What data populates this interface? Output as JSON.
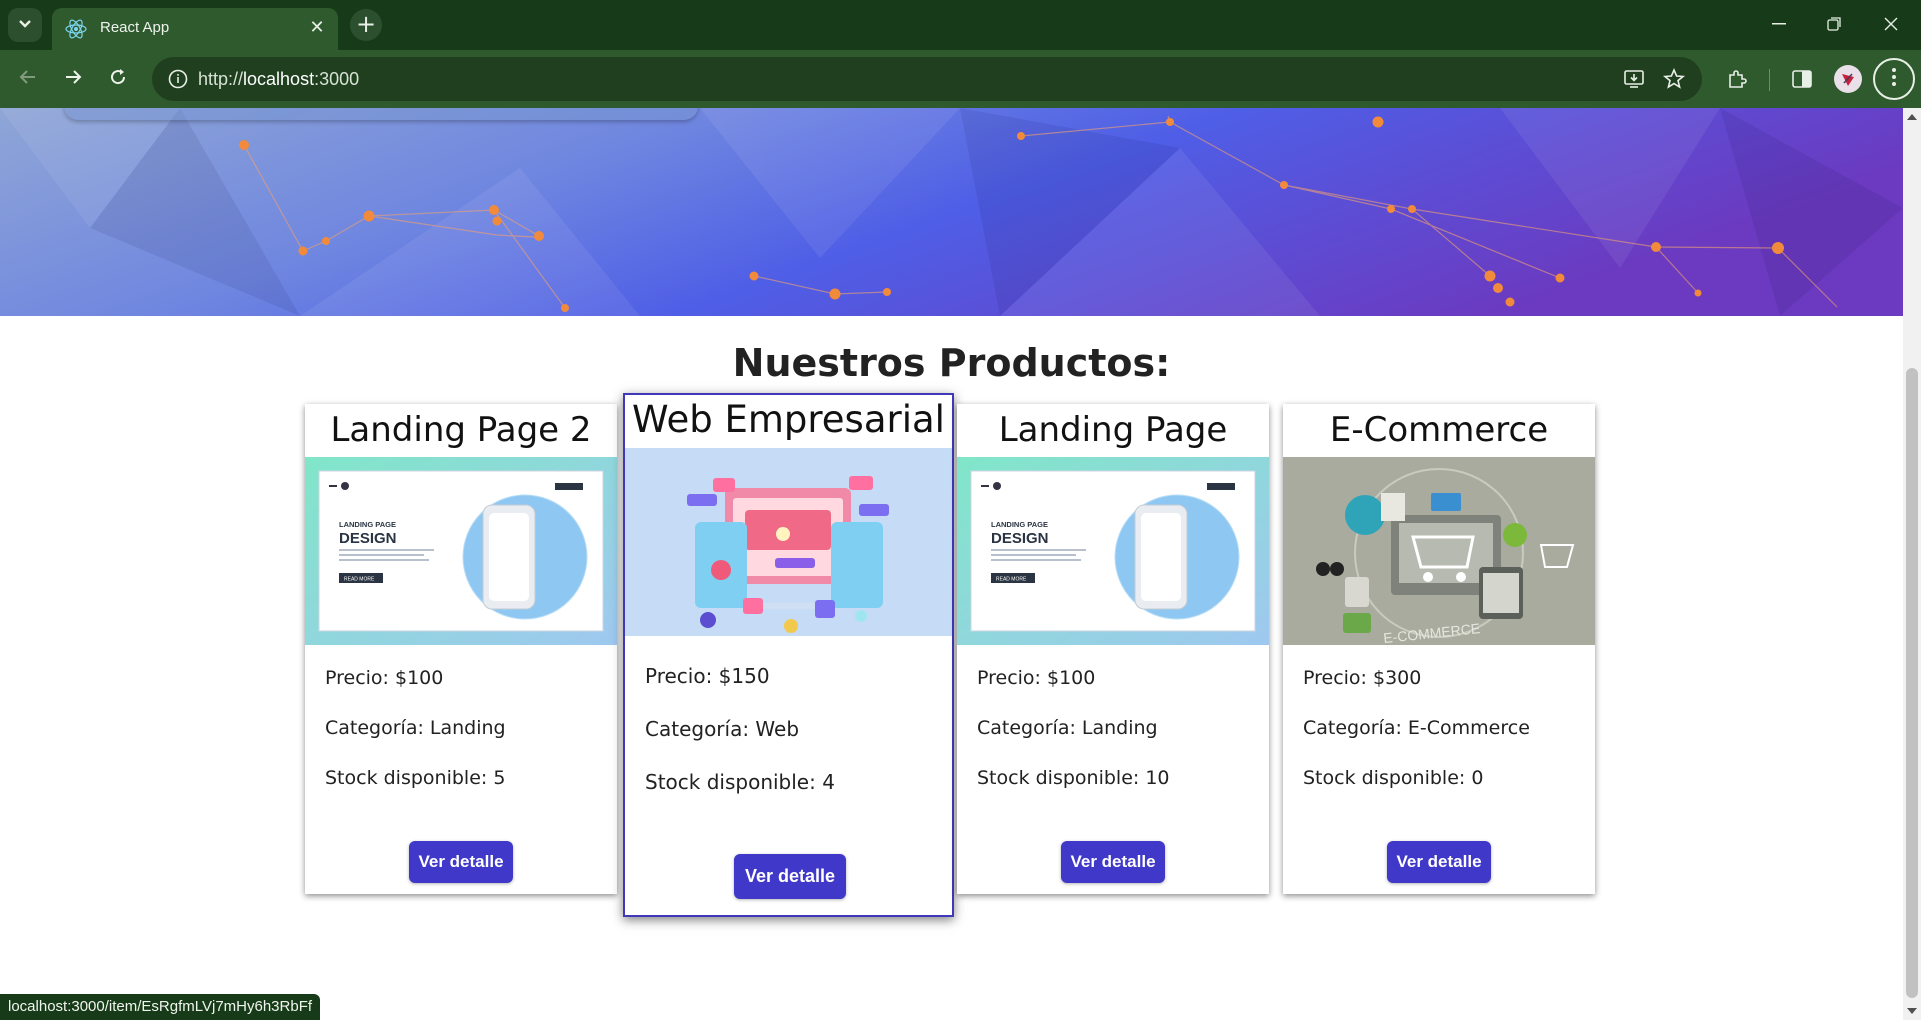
{
  "browser": {
    "tab_title": "React App",
    "url_scheme": "http://",
    "url_host": "localhost",
    "url_port": ":3000",
    "status_url": "localhost:3000/item/EsRgfmLVj7mHy6h3RbFf"
  },
  "page": {
    "section_title": "Nuestros Productos:"
  },
  "products": [
    {
      "title": "Landing Page 2",
      "price": "Precio: $100",
      "category": "Categoría: Landing",
      "stock": "Stock disponible: 5",
      "button": "Ver detalle",
      "image": "landing-page-design-illustration"
    },
    {
      "title": "Web Empresarial",
      "price": "Precio: $150",
      "category": "Categoría: Web",
      "stock": "Stock disponible: 4",
      "button": "Ver detalle",
      "image": "web-devices-illustration"
    },
    {
      "title": "Landing Page",
      "price": "Precio: $100",
      "category": "Categoría: Landing",
      "stock": "Stock disponible: 10",
      "button": "Ver detalle",
      "image": "landing-page-design-illustration"
    },
    {
      "title": "E-Commerce",
      "price": "Precio: $300",
      "category": "Categoría: E-Commerce",
      "stock": "Stock disponible: 0",
      "button": "Ver detalle",
      "image": "ecommerce-cart-illustration"
    }
  ],
  "landing_image_text": {
    "label_small": "LANDING PAGE",
    "label_big": "DESIGN",
    "read_more": "READ MORE"
  },
  "ecommerce_image_text": {
    "ring_label": "E-COMMERCE"
  },
  "colors": {
    "browser_frame": "#173b18",
    "toolbar": "#2f5a2e",
    "button_blue": "#4038c8",
    "hover_border": "#4038b8"
  }
}
